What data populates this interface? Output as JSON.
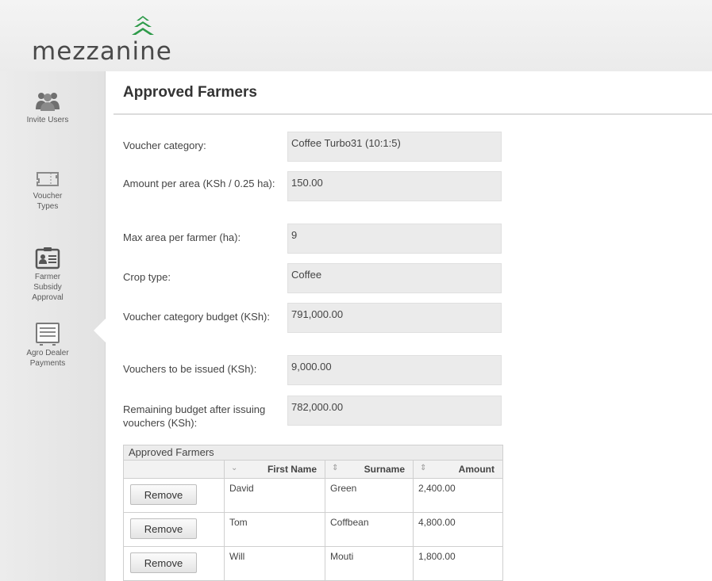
{
  "brand": {
    "name": "mezzanine",
    "accent": "#2e9b4a"
  },
  "sidebar": {
    "items": [
      {
        "label": "Invite Users",
        "icon": "users-icon"
      },
      {
        "label": "Voucher Types",
        "icon": "voucher-icon"
      },
      {
        "label": "Farmer Subsidy Approval",
        "icon": "id-card-icon",
        "active": true
      },
      {
        "label": "Agro Dealer Payments",
        "icon": "document-icon"
      }
    ]
  },
  "page": {
    "title": "Approved Farmers"
  },
  "form": {
    "fields": [
      {
        "label": "Voucher category:",
        "value": "Coffee Turbo31 (10:1:5)"
      },
      {
        "label": "Amount per area (KSh / 0.25 ha):",
        "value": "150.00"
      },
      {
        "label": "Max area per farmer (ha):",
        "value": "9"
      },
      {
        "label": "Crop type:",
        "value": "Coffee"
      },
      {
        "label": "Voucher category budget (KSh):",
        "value": "791,000.00"
      },
      {
        "label": "Vouchers to be issued (KSh):",
        "value": "9,000.00"
      },
      {
        "label": "Remaining budget after issuing vouchers (KSh):",
        "value": "782,000.00"
      }
    ]
  },
  "grid": {
    "caption": "Approved Farmers",
    "columns": [
      "",
      "First Name",
      "Surname",
      "Amount"
    ],
    "sort_glyphs": [
      "⌄",
      "⇕",
      "⇕"
    ],
    "remove_label": "Remove",
    "rows": [
      {
        "first": "David",
        "surname": "Green",
        "amount": "2,400.00"
      },
      {
        "first": "Tom",
        "surname": "Coffbean",
        "amount": "4,800.00"
      },
      {
        "first": "Will",
        "surname": "Mouti",
        "amount": "1,800.00"
      }
    ]
  }
}
